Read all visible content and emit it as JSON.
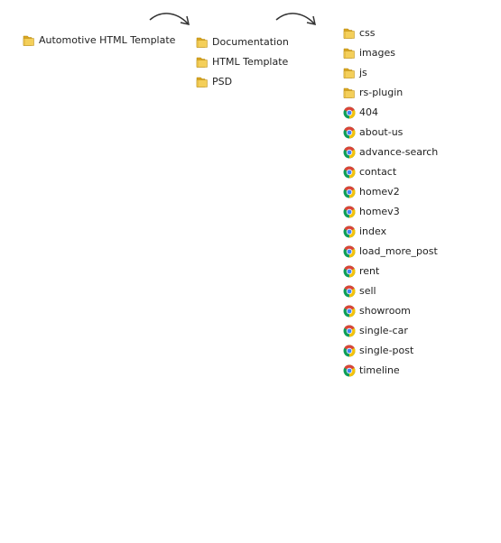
{
  "root": {
    "items": [
      {
        "label": "Automotive HTML Template",
        "icon": "folder-icon"
      }
    ]
  },
  "package": {
    "items": [
      {
        "label": "Documentation",
        "icon": "folder-icon"
      },
      {
        "label": "HTML Template",
        "icon": "folder-icon"
      },
      {
        "label": "PSD",
        "icon": "folder-icon"
      }
    ]
  },
  "html_template": {
    "items": [
      {
        "label": "css",
        "icon": "folder-icon"
      },
      {
        "label": "images",
        "icon": "folder-icon"
      },
      {
        "label": "js",
        "icon": "folder-icon"
      },
      {
        "label": "rs-plugin",
        "icon": "folder-icon"
      },
      {
        "label": "404",
        "icon": "chrome-icon"
      },
      {
        "label": "about-us",
        "icon": "chrome-icon"
      },
      {
        "label": "advance-search",
        "icon": "chrome-icon"
      },
      {
        "label": "contact",
        "icon": "chrome-icon"
      },
      {
        "label": "homev2",
        "icon": "chrome-icon"
      },
      {
        "label": "homev3",
        "icon": "chrome-icon"
      },
      {
        "label": "index",
        "icon": "chrome-icon"
      },
      {
        "label": "load_more_post",
        "icon": "chrome-icon"
      },
      {
        "label": "rent",
        "icon": "chrome-icon"
      },
      {
        "label": "sell",
        "icon": "chrome-icon"
      },
      {
        "label": "showroom",
        "icon": "chrome-icon"
      },
      {
        "label": "single-car",
        "icon": "chrome-icon"
      },
      {
        "label": "single-post",
        "icon": "chrome-icon"
      },
      {
        "label": "timeline",
        "icon": "chrome-icon"
      }
    ]
  },
  "colors": {
    "folder_back": "#d9a520",
    "folder_front": "#f4cf5a",
    "folder_edge": "#b78a12",
    "chrome_red": "#db4437",
    "chrome_yellow": "#f4c20d",
    "chrome_green": "#0f9d58",
    "chrome_blue": "#4285f4",
    "arrow": "#333333",
    "text": "#222222"
  }
}
